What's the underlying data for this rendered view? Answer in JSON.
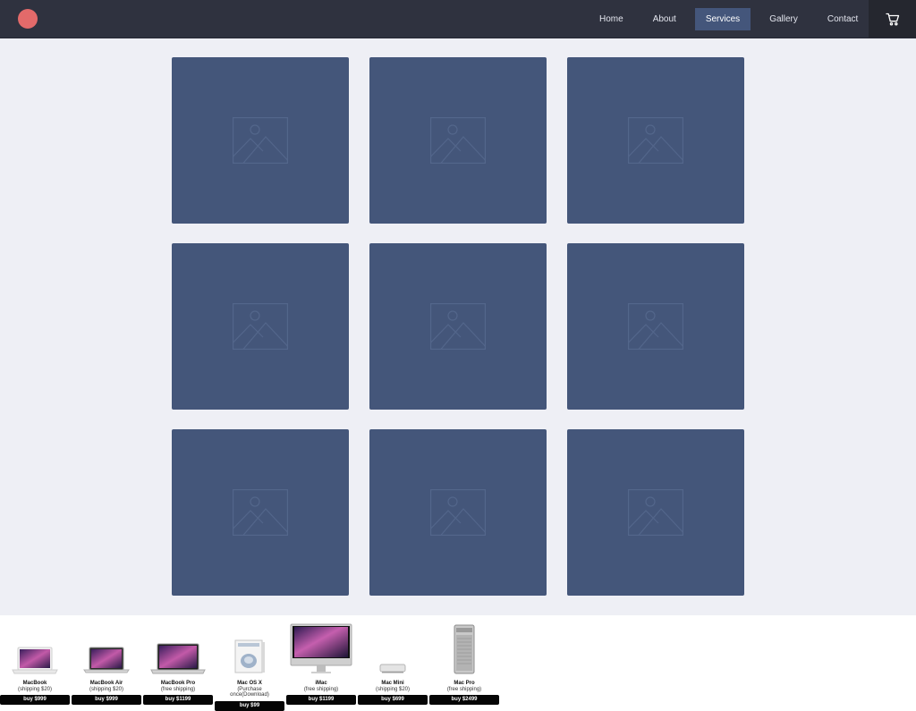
{
  "header": {
    "logo_color": "#e36a6a",
    "nav": [
      {
        "label": "Home",
        "active": false
      },
      {
        "label": "About",
        "active": false
      },
      {
        "label": "Services",
        "active": true
      },
      {
        "label": "Gallery",
        "active": false
      },
      {
        "label": "Contact",
        "active": false
      }
    ],
    "cart_icon": "cart-icon"
  },
  "gallery": {
    "tile_color": "#44567a",
    "tile_icon": "image-placeholder-icon",
    "tile_count": 9
  },
  "products": [
    {
      "name": "MacBook",
      "shipping": "(shipping $20)",
      "buy": "buy $999"
    },
    {
      "name": "MacBook Air",
      "shipping": "(shipping $20)",
      "buy": "buy $999"
    },
    {
      "name": "MacBook Pro",
      "shipping": "(free shipping)",
      "buy": "buy $1199"
    },
    {
      "name": "Mac OS X",
      "shipping": "(Purchase once(Download)",
      "buy": "buy $99"
    },
    {
      "name": "iMac",
      "shipping": "(free shipping)",
      "buy": "buy $1199"
    },
    {
      "name": "Mac Mini",
      "shipping": "(shipping $20)",
      "buy": "buy $699"
    },
    {
      "name": "Mac Pro",
      "shipping": "(free shipping)",
      "buy": "buy $2499"
    }
  ]
}
